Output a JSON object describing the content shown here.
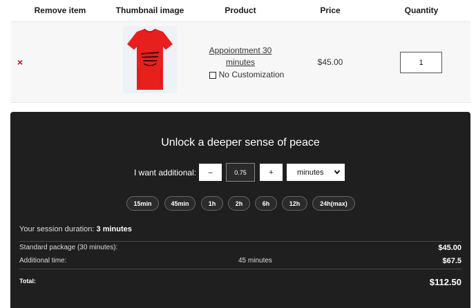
{
  "table": {
    "headers": {
      "remove": "Remove item",
      "thumbnail": "Thumbnail image",
      "product": "Product",
      "price": "Price",
      "quantity": "Quantity"
    },
    "row": {
      "remove_icon": "close-icon",
      "remove_glyph": "×",
      "product_name": "Appoiontment 30 minutes",
      "customization": "No Customization",
      "price": "$45.00",
      "quantity": "1"
    }
  },
  "panel": {
    "title": "Unlock a deeper sense of peace",
    "want_label": "I want additional:",
    "minus_label": "–",
    "plus_label": "+",
    "amount": "0.75",
    "unit": "minutes",
    "presets": [
      "15min",
      "45min",
      "1h",
      "2h",
      "6h",
      "12h",
      "24h(max)"
    ],
    "duration_label": "Your session duration:",
    "duration_value": "3 minutes",
    "standard_label": "Standard package (30 minutes):",
    "standard_value": "$45.00",
    "additional_label": "Additional time:",
    "additional_mid": "45 minutes",
    "additional_value": "$67.5",
    "total_label": "Total:",
    "total_value": "$112.50"
  },
  "colors": {
    "panel_bg": "#1f1f1f",
    "remove_red": "#c0111a",
    "shirt_red": "#e8201d"
  }
}
